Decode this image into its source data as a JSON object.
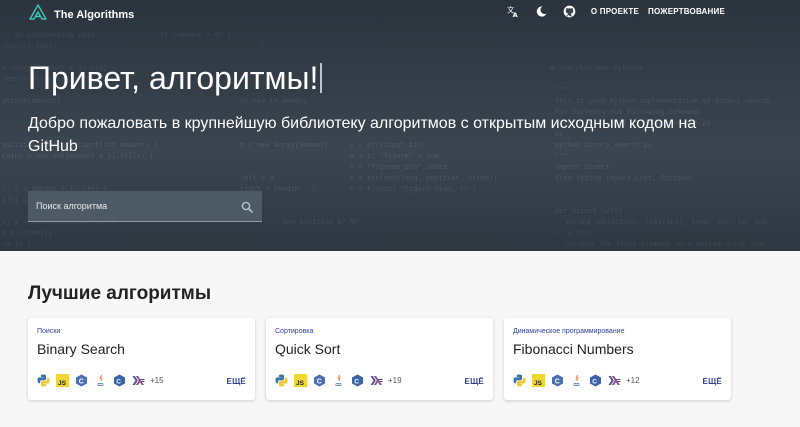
{
  "header": {
    "brand_name": "The Algorithms",
    "icons": [
      "translate-icon",
      "theme-toggle-icon",
      "github-icon"
    ],
    "links": [
      "О ПРОЕКТЕ",
      "ПОЖЕРТВОВАНИЕ"
    ]
  },
  "hero": {
    "title": "Привет, алгоритмы!",
    "subtitle": "Добро пожаловать в крупнейшую библиотеку алгоритмов с открытым исходным кодом на GitHub",
    "search_placeholder": "Поиск алгоритма"
  },
  "top_algorithms": {
    "title": "Лучшие алгоритмы",
    "more_label": "ЕЩЁ",
    "cards": [
      {
        "category": "Поиски",
        "name": "Binary Search",
        "extra_count": "+15",
        "languages": [
          "python",
          "javascript",
          "c",
          "java",
          "csharp",
          "haskell"
        ]
      },
      {
        "category": "Сортировка",
        "name": "Quick Sort",
        "extra_count": "+19",
        "languages": [
          "python",
          "javascript",
          "c",
          "java",
          "csharp",
          "haskell"
        ]
      },
      {
        "category": "Динамическое программирование",
        "name": "Fibonacci Numbers",
        "extra_count": "+12",
        "languages": [
          "python",
          "javascript",
          "c",
          "java",
          "csharp",
          "haskell"
        ]
      }
    ]
  },
  "colors": {
    "hero_bg": "#3a4550",
    "accent": "#2e3f9a",
    "page_bg": "#f7f7f7",
    "card_bg": "#ffffff"
  }
}
